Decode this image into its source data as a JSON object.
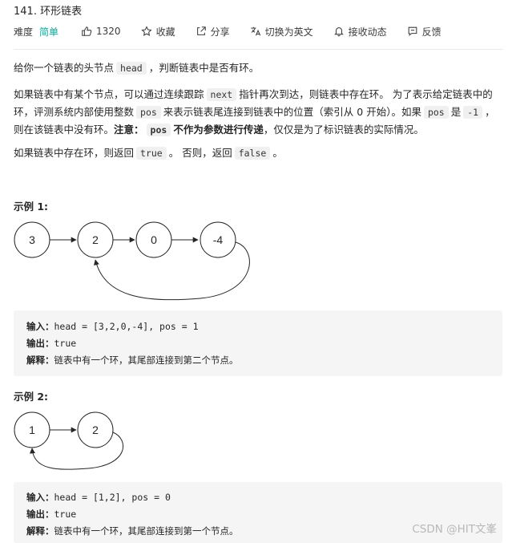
{
  "problem": {
    "title": "141. 环形链表"
  },
  "meta": {
    "difficulty_label": "难度",
    "difficulty_value": "简单",
    "like_count": "1320",
    "favorite_label": "收藏",
    "share_label": "分享",
    "switch_lang_label": "切换为英文",
    "subscribe_label": "接收动态",
    "feedback_label": "反馈",
    "colors": {
      "easy": "#00af9b"
    },
    "icons": [
      "thumbs-up-icon",
      "star-icon",
      "share-icon",
      "translate-icon",
      "bell-icon",
      "feedback-icon"
    ]
  },
  "description": {
    "p1_a": "给你一个链表的头节点",
    "p1_code": "head",
    "p1_b": "，判断链表中是否有环。",
    "p2_a": "如果链表中有某个节点，可以通过连续跟踪",
    "p2_code1": "next",
    "p2_b": "指针再次到达，则链表中存在环。 为了表示给定链表中的环，评测系统内部使用整数",
    "p2_code2": "pos",
    "p2_c": "来表示链表尾连接到链表中的位置（索引从 0 开始）。如果",
    "p2_code3": "pos",
    "p2_d": "是",
    "p2_code4": "-1",
    "p2_e": "，则在该链表中没有环。",
    "p2_note_label": "注意：",
    "p2_note_code": "pos",
    "p2_note_bold": "不作为参数进行传递",
    "p2_f": "，仅仅是为了标识链表的实际情况。",
    "p3_a": "如果链表中存在环，则返回",
    "p3_code1": "true",
    "p3_b": "。 否则，返回",
    "p3_code2": "false",
    "p3_c": "。"
  },
  "examples": [
    {
      "title": "示例 1:",
      "nodes": [
        "3",
        "2",
        "0",
        "-4"
      ],
      "input_label": "输入：",
      "input": "head = [3,2,0,-4], pos = 1",
      "output_label": "输出：",
      "output": "true",
      "explain_label": "解释：",
      "explain": "链表中有一个环，其尾部连接到第二个节点。"
    },
    {
      "title": "示例 2:",
      "nodes": [
        "1",
        "2"
      ],
      "input_label": "输入：",
      "input": "head = [1,2], pos = 0",
      "output_label": "输出：",
      "output": "true",
      "explain_label": "解释：",
      "explain": "链表中有一个环，其尾部连接到第一个节点。"
    }
  ],
  "watermark": "CSDN @HIT文峯"
}
